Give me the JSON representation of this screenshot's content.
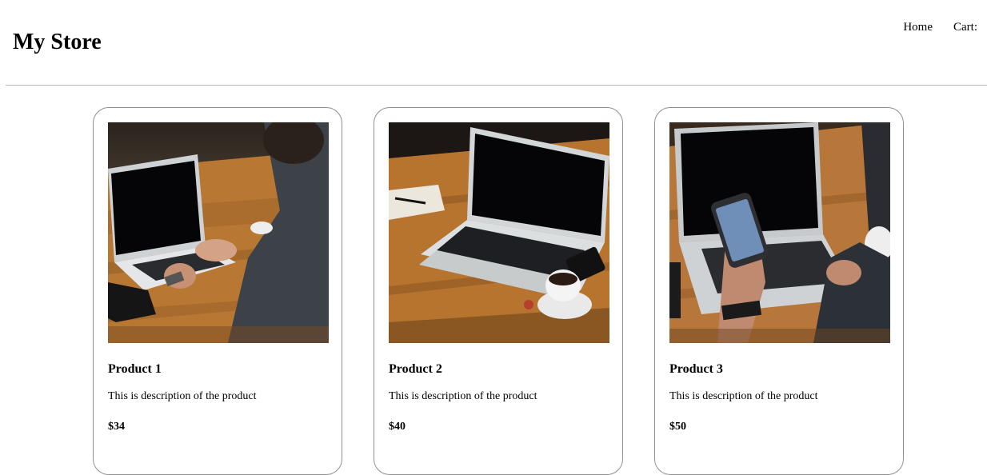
{
  "header": {
    "title": "My Store",
    "nav": [
      {
        "label": "Home"
      },
      {
        "label": "Cart:"
      }
    ]
  },
  "products": [
    {
      "name": "Product 1",
      "description": "This is description of the product",
      "price": "$34",
      "image_icon": "laptop-typing-photo"
    },
    {
      "name": "Product 2",
      "description": "This is description of the product",
      "price": "$40",
      "image_icon": "laptop-coffee-photo"
    },
    {
      "name": "Product 3",
      "description": "This is description of the product",
      "price": "$50",
      "image_icon": "phone-laptop-photo"
    }
  ],
  "colors": {
    "wood": "#b8732f",
    "wood_dark": "#7a4a1f",
    "laptop_silver": "#d5d7d9",
    "screen": "#0a0a0c",
    "shirt": "#3a3e45",
    "skin": "#c9957a",
    "divider": "#b8b8b8",
    "card_border": "#8f8f8f"
  }
}
